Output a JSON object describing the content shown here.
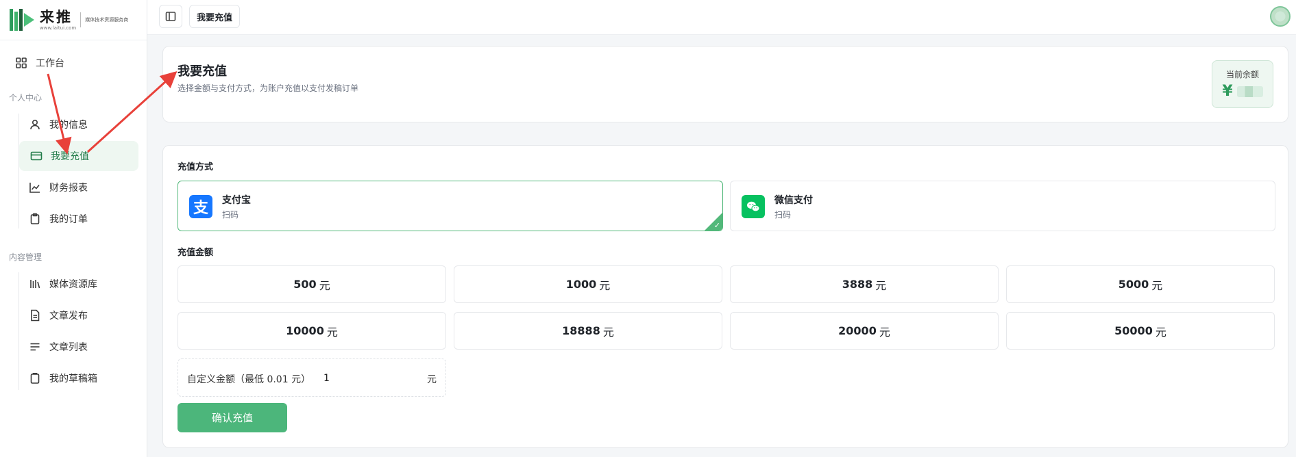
{
  "brand": {
    "name": "来推",
    "url": "www.laitui.com",
    "slogan": "媒体技术资源服务商",
    "colors": {
      "green": "#2e9b5c",
      "dark": "#1f5f3a"
    }
  },
  "sidebar": {
    "top_item": {
      "label": "工作台",
      "icon": "grid-icon"
    },
    "sections": [
      {
        "label": "个人中心",
        "items": [
          {
            "label": "我的信息",
            "icon": "user-icon"
          },
          {
            "label": "我要充值",
            "icon": "card-icon",
            "active": true
          },
          {
            "label": "财务报表",
            "icon": "chart-icon"
          },
          {
            "label": "我的订单",
            "icon": "clipboard-icon"
          }
        ]
      },
      {
        "label": "内容管理",
        "items": [
          {
            "label": "媒体资源库",
            "icon": "library-icon"
          },
          {
            "label": "文章发布",
            "icon": "document-icon"
          },
          {
            "label": "文章列表",
            "icon": "list-icon"
          },
          {
            "label": "我的草稿箱",
            "icon": "draft-icon"
          }
        ]
      }
    ]
  },
  "topbar": {
    "tab_label": "我要充值"
  },
  "header": {
    "title": "我要充值",
    "subtitle": "选择金额与支付方式，为账户充值以支付发稿订单",
    "balance_label": "当前余额",
    "balance_currency": "¥"
  },
  "payment": {
    "section_label": "充值方式",
    "methods": [
      {
        "name": "支付宝",
        "desc": "扫码",
        "glyph": "支",
        "color": "#1677ff",
        "selected": true
      },
      {
        "name": "微信支付",
        "desc": "扫码",
        "color": "#07c160",
        "selected": false
      }
    ]
  },
  "amount": {
    "section_label": "充值金额",
    "unit": "元",
    "options": [
      "500",
      "1000",
      "3888",
      "5000",
      "10000",
      "18888",
      "20000",
      "50000"
    ],
    "custom_label": "自定义金额（最低 0.01 元）",
    "custom_value": "1",
    "custom_unit": "元"
  },
  "confirm_label": "确认充值",
  "colors": {
    "accent": "#4cb67b",
    "active_bg": "#eef7f1",
    "annotation_red": "#e8413a"
  }
}
